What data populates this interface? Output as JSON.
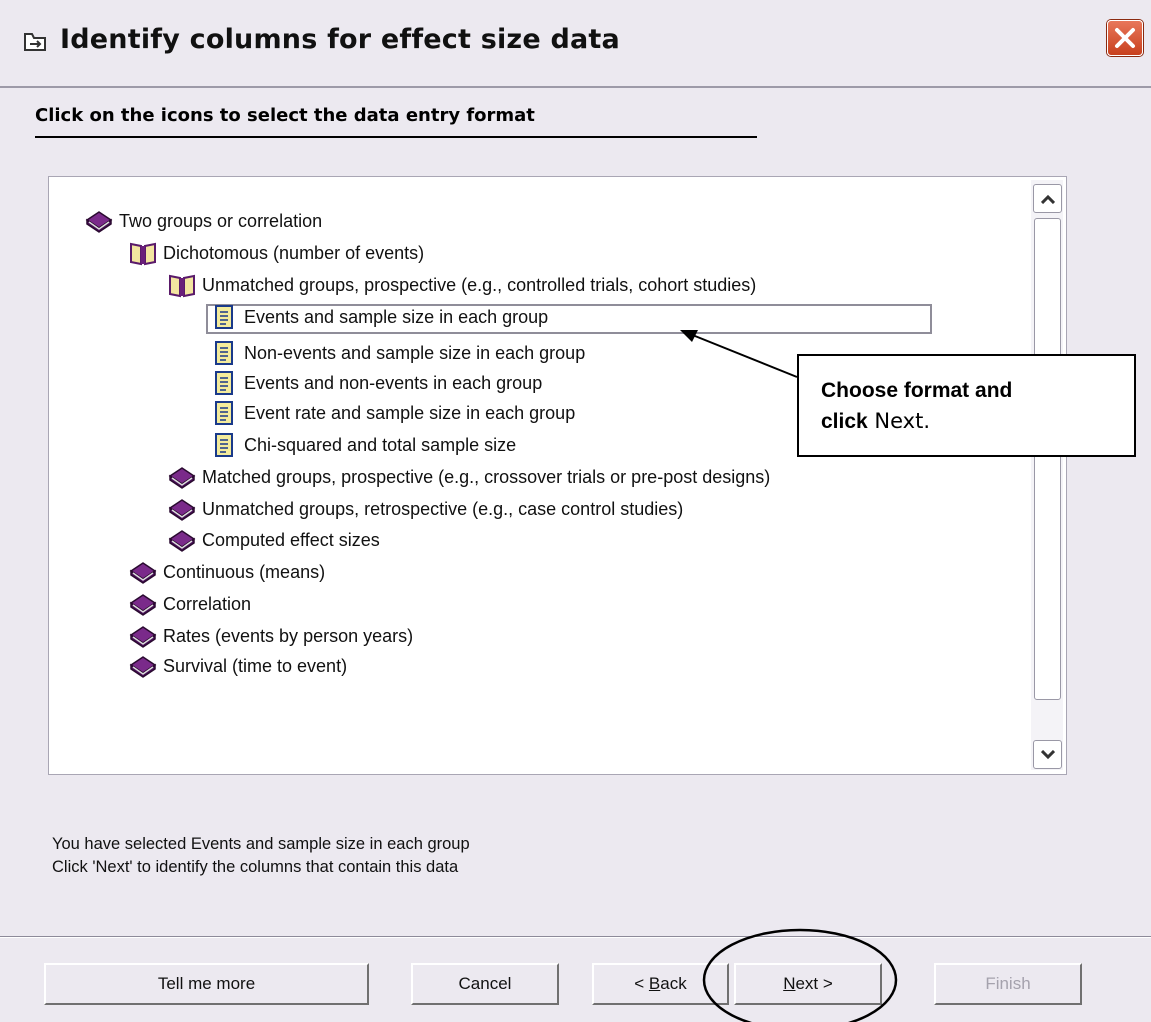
{
  "window": {
    "title": "Identify columns for effect size data"
  },
  "heading": "Click on the icons to select the data entry format",
  "tree": {
    "items": [
      {
        "label": "Two groups or correlation",
        "icon": "closed-book-icon"
      },
      {
        "label": "Dichotomous (number of events)",
        "icon": "open-book-icon"
      },
      {
        "label": "Unmatched groups, prospective (e.g., controlled trials, cohort studies)",
        "icon": "open-book-icon"
      },
      {
        "label": "Events and sample size in each group",
        "icon": "page-icon",
        "selected": true
      },
      {
        "label": "Non-events and sample size in each group",
        "icon": "page-icon"
      },
      {
        "label": "Events and non-events in each group",
        "icon": "page-icon"
      },
      {
        "label": "Event rate and sample size in each group",
        "icon": "page-icon"
      },
      {
        "label": "Chi-squared and total sample size",
        "icon": "page-icon"
      },
      {
        "label": "Matched groups, prospective (e.g., crossover trials or pre-post designs)",
        "icon": "closed-book-icon"
      },
      {
        "label": "Unmatched groups, retrospective (e.g., case control studies)",
        "icon": "closed-book-icon"
      },
      {
        "label": "Computed effect sizes",
        "icon": "closed-book-icon"
      },
      {
        "label": "Continuous (means)",
        "icon": "closed-book-icon"
      },
      {
        "label": "Correlation",
        "icon": "closed-book-icon"
      },
      {
        "label": "Rates (events by person years)",
        "icon": "closed-book-icon"
      },
      {
        "label": "Survival (time to event)",
        "icon": "closed-book-icon"
      }
    ]
  },
  "callout": {
    "bold1": "Choose format and",
    "bold2": "click",
    "regular": " Next."
  },
  "status": {
    "line1": "You have selected Events and sample size in each group",
    "line2": "Click 'Next' to identify the columns that contain this data"
  },
  "buttons": {
    "tell_me_more": "Tell me more",
    "cancel": "Cancel",
    "back_prefix": "< ",
    "back_mnemonic": "B",
    "back_rest": "ack",
    "next_mnemonic": "N",
    "next_rest": "ext >",
    "finish": "Finish"
  },
  "colors": {
    "book": "#6a1f7a",
    "page": "#f4ec9c",
    "close": "#d4502c"
  }
}
